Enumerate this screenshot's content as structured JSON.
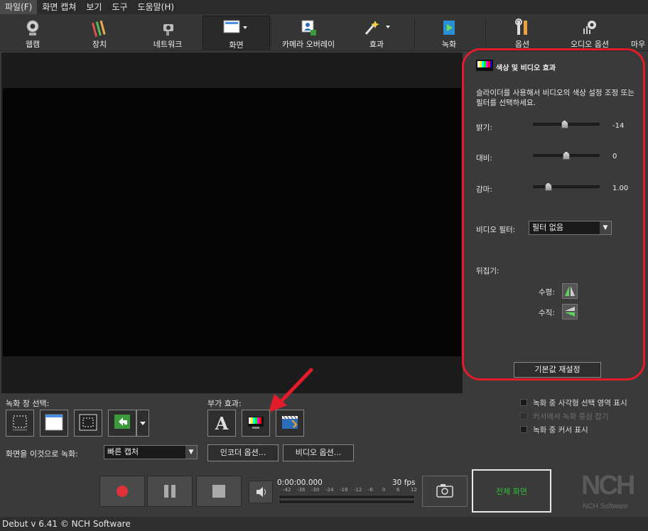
{
  "menu": [
    "파일(F)",
    "화면 캡쳐",
    "보기",
    "도구",
    "도움말(H)"
  ],
  "toolbar": {
    "webcam": "웹캠",
    "device": "장치",
    "network": "네트워크",
    "screen": "화면",
    "camera_overlay": "카메라 오버레이",
    "effects": "효과",
    "record": "녹화",
    "options": "옵션",
    "audio_options": "오디오 옵션",
    "mouse": "마우"
  },
  "panel": {
    "title": "색상 및 비디오 효과",
    "description": "슬라이더를 사용해서 비디오의 색상 설정 조정 또는 필터를 선택하세요.",
    "brightness_label": "밝기:",
    "brightness_value": "-14",
    "brightness_level": 0.47,
    "contrast_label": "대비:",
    "contrast_value": "0",
    "contrast_level": 0.5,
    "gamma_label": "감마:",
    "gamma_value": "1.00",
    "gamma_level": 0.19,
    "filter_label": "비디오 필터:",
    "filter_value": "필터 없음",
    "flip_label": "뒤집기:",
    "horizontal_label": "수평:",
    "vertical_label": "수직:",
    "reset_button": "기본값 재설정"
  },
  "bottom": {
    "record_window_label": "녹화 창 선택:",
    "extra_effects_label": "부가 효과:",
    "record_as_label": "화면을 이것으로 녹화:",
    "record_as_value": "빠른 캡처",
    "encoder_options": "인코더 옵션...",
    "video_options": "비디오 옵션...",
    "timecode": "0:00:00.000",
    "fps": "30 fps",
    "meter_ticks": [
      "-42",
      "-36",
      "-30",
      "-24",
      "-18",
      "-12",
      "-6",
      "0",
      "6",
      "12"
    ],
    "fullscreen": "전체 화면",
    "checkbox1": "녹화 중 사각형 선택 영역 표시",
    "checkbox2": "커서에서 녹화 중심 잡기",
    "checkbox3": "녹화 중 커서 표시",
    "logo_text": "NCH",
    "logo_sub": "NCH Software"
  },
  "status": "Debut v 6.41 © NCH Software",
  "colors": {
    "annotation_red": "#e21c2b",
    "fullscreen_text": "#2fbf3a"
  }
}
